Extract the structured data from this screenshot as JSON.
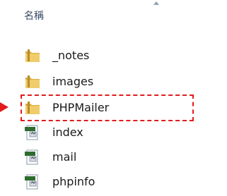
{
  "header": {
    "column_name": "名稱"
  },
  "files": [
    {
      "name": "_notes",
      "type": "folder"
    },
    {
      "name": "images",
      "type": "folder"
    },
    {
      "name": "PHPMailer",
      "type": "folder",
      "highlighted": true
    },
    {
      "name": "index",
      "type": "php-file"
    },
    {
      "name": "mail",
      "type": "php-file"
    },
    {
      "name": "phpinfo",
      "type": "php-file"
    }
  ],
  "colors": {
    "highlight_border": "#e21b1b",
    "folder": "#e9c35a",
    "text": "#1a1a1a"
  }
}
